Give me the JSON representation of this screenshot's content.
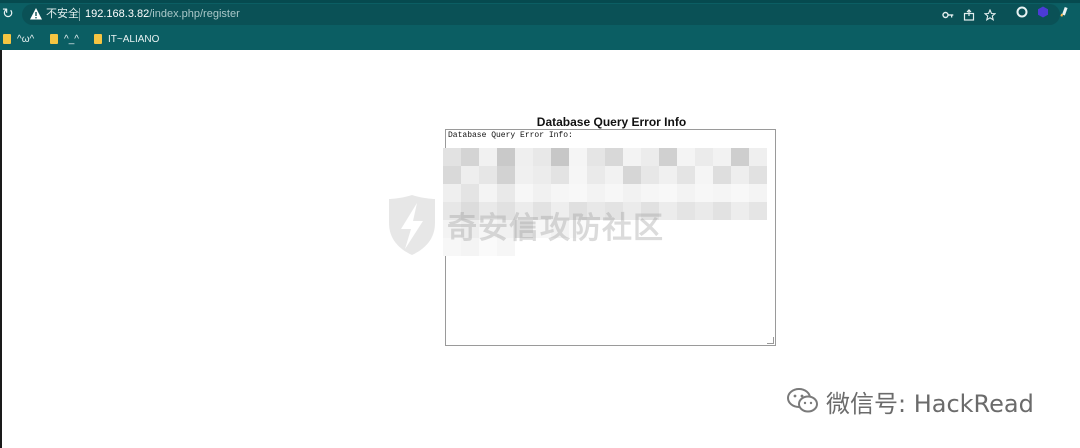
{
  "browser": {
    "address": {
      "insecure_label": "不安全",
      "url_host": "192.168.3.82",
      "url_path": "/index.php/register"
    },
    "bookmarks": [
      {
        "label": "^ω^"
      },
      {
        "label": "^_^"
      },
      {
        "label": "IT~ALIANO"
      }
    ]
  },
  "page": {
    "title": "Database Query Error Info",
    "error_box_text": "Database Query Error Info:"
  },
  "watermarks": {
    "center": "奇安信攻防社区",
    "wechat": "微信号: HackRead"
  },
  "colors": {
    "browser_bar": "#0b5e63",
    "bookmark_folder": "#f5c542"
  }
}
